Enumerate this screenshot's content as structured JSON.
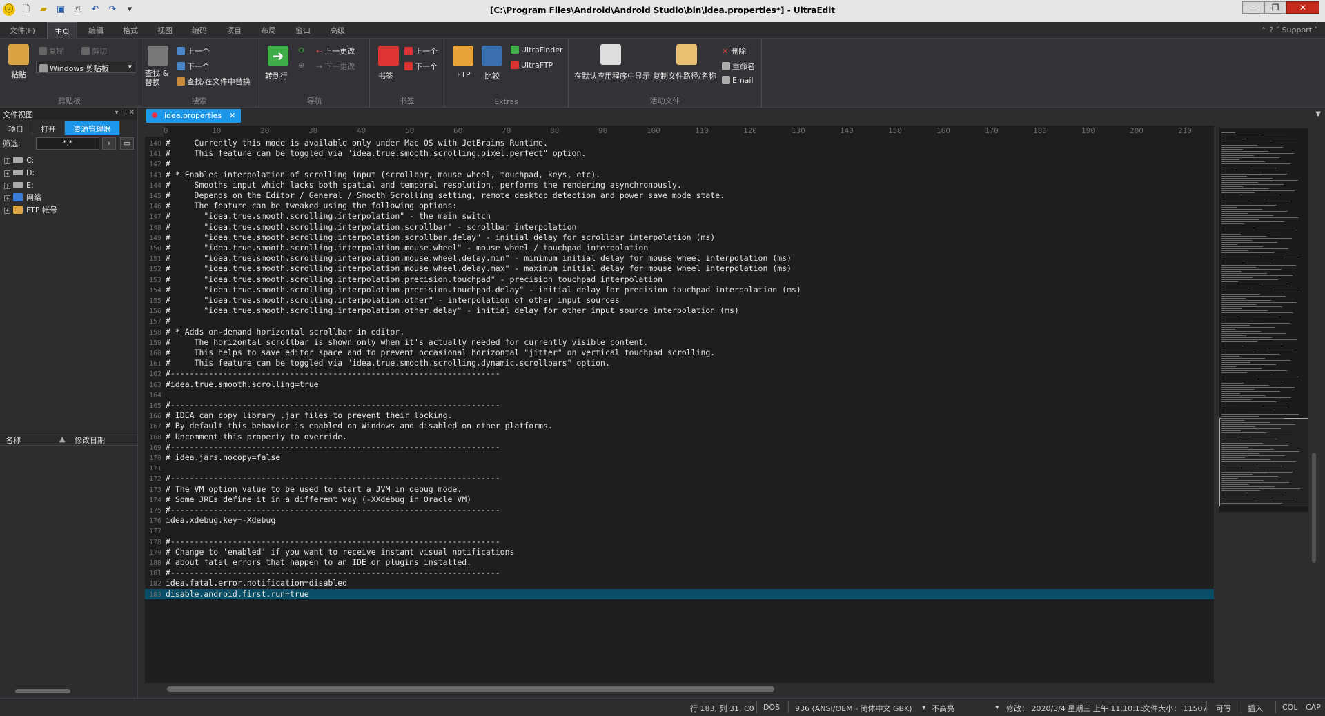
{
  "window": {
    "title": "[C:\\Program Files\\Android\\Android Studio\\bin\\idea.properties*] - UltraEdit",
    "min": "–",
    "max": "❐",
    "close": "✕"
  },
  "menubar": {
    "tabs": [
      "文件(F)",
      "主页",
      "编辑",
      "格式",
      "视图",
      "编码",
      "项目",
      "布局",
      "窗口",
      "高级"
    ],
    "active": "主页",
    "right": "⌃ ? ˅ Support ˅"
  },
  "ribbon": {
    "clipboard": {
      "paste": "粘贴",
      "copy": "复制",
      "cut": "剪切",
      "clip": "Windows 剪贴板",
      "label": "剪贴板"
    },
    "search": {
      "find_replace": "查找 &\n替换",
      "up": "上一个",
      "down": "下一个",
      "find_in_files": "查找/在文件中替换",
      "label": "搜索"
    },
    "nav": {
      "goto": "转到行",
      "prev_change": "上一更改",
      "next_change": "下一更改",
      "label": "导航"
    },
    "bookmarks": {
      "bookmark": "书签",
      "prev": "上一个",
      "next": "下一个",
      "label": "书签"
    },
    "extras": {
      "ftp": "FTP",
      "compare": "比较",
      "finder": "UltraFinder",
      "ultraftp": "UltraFTP",
      "label": "Extras"
    },
    "active": {
      "open_default": "在默认应用程序中显示",
      "copy_path": "复制文件路径/名称",
      "delete": "删除",
      "rename": "重命名",
      "email": "Email",
      "label": "活动文件"
    }
  },
  "sidebar": {
    "title": "文件视图",
    "tabs": [
      "项目",
      "打开",
      "资源管理器"
    ],
    "active_tab": "资源管理器",
    "filter_label": "筛选:",
    "filter_value": "*.*",
    "drives": [
      {
        "label": "C:"
      },
      {
        "label": "D:"
      },
      {
        "label": "E:"
      },
      {
        "label": "网络"
      },
      {
        "label": "FTP 帐号"
      }
    ],
    "col_name": "名称",
    "col_date": "修改日期"
  },
  "tab": {
    "name": "idea.properties",
    "close": "✕"
  },
  "lines": [
    {
      "n": "140",
      "t": "#     Currently this mode is available only under Mac OS with JetBrains Runtime."
    },
    {
      "n": "141",
      "t": "#     This feature can be toggled via \"idea.true.smooth.scrolling.pixel.perfect\" option."
    },
    {
      "n": "142",
      "t": "#"
    },
    {
      "n": "143",
      "t": "# * Enables interpolation of scrolling input (scrollbar, mouse wheel, touchpad, keys, etc)."
    },
    {
      "n": "144",
      "t": "#     Smooths input which lacks both spatial and temporal resolution, performs the rendering asynchronously."
    },
    {
      "n": "145",
      "t": "#     Depends on the Editor / General / Smooth Scrolling setting, remote desktop detection and power save mode state."
    },
    {
      "n": "146",
      "t": "#     The feature can be tweaked using the following options:"
    },
    {
      "n": "147",
      "t": "#       \"idea.true.smooth.scrolling.interpolation\" - the main switch"
    },
    {
      "n": "148",
      "t": "#       \"idea.true.smooth.scrolling.interpolation.scrollbar\" - scrollbar interpolation"
    },
    {
      "n": "149",
      "t": "#       \"idea.true.smooth.scrolling.interpolation.scrollbar.delay\" - initial delay for scrollbar interpolation (ms)"
    },
    {
      "n": "150",
      "t": "#       \"idea.true.smooth.scrolling.interpolation.mouse.wheel\" - mouse wheel / touchpad interpolation"
    },
    {
      "n": "151",
      "t": "#       \"idea.true.smooth.scrolling.interpolation.mouse.wheel.delay.min\" - minimum initial delay for mouse wheel interpolation (ms)"
    },
    {
      "n": "152",
      "t": "#       \"idea.true.smooth.scrolling.interpolation.mouse.wheel.delay.max\" - maximum initial delay for mouse wheel interpolation (ms)"
    },
    {
      "n": "153",
      "t": "#       \"idea.true.smooth.scrolling.interpolation.precision.touchpad\" - precision touchpad interpolation"
    },
    {
      "n": "154",
      "t": "#       \"idea.true.smooth.scrolling.interpolation.precision.touchpad.delay\" - initial delay for precision touchpad interpolation (ms)"
    },
    {
      "n": "155",
      "t": "#       \"idea.true.smooth.scrolling.interpolation.other\" - interpolation of other input sources"
    },
    {
      "n": "156",
      "t": "#       \"idea.true.smooth.scrolling.interpolation.other.delay\" - initial delay for other input source interpolation (ms)"
    },
    {
      "n": "157",
      "t": "#"
    },
    {
      "n": "158",
      "t": "# * Adds on-demand horizontal scrollbar in editor."
    },
    {
      "n": "159",
      "t": "#     The horizontal scrollbar is shown only when it's actually needed for currently visible content."
    },
    {
      "n": "160",
      "t": "#     This helps to save editor space and to prevent occasional horizontal \"jitter\" on vertical touchpad scrolling."
    },
    {
      "n": "161",
      "t": "#     This feature can be toggled via \"idea.true.smooth.scrolling.dynamic.scrollbars\" option."
    },
    {
      "n": "162",
      "t": "#---------------------------------------------------------------------"
    },
    {
      "n": "163",
      "t": "#idea.true.smooth.scrolling=true"
    },
    {
      "n": "164",
      "t": ""
    },
    {
      "n": "165",
      "t": "#---------------------------------------------------------------------"
    },
    {
      "n": "166",
      "t": "# IDEA can copy library .jar files to prevent their locking."
    },
    {
      "n": "167",
      "t": "# By default this behavior is enabled on Windows and disabled on other platforms."
    },
    {
      "n": "168",
      "t": "# Uncomment this property to override."
    },
    {
      "n": "169",
      "t": "#---------------------------------------------------------------------"
    },
    {
      "n": "170",
      "t": "# idea.jars.nocopy=false"
    },
    {
      "n": "171",
      "t": ""
    },
    {
      "n": "172",
      "t": "#---------------------------------------------------------------------"
    },
    {
      "n": "173",
      "t": "# The VM option value to be used to start a JVM in debug mode."
    },
    {
      "n": "174",
      "t": "# Some JREs define it in a different way (-XXdebug in Oracle VM)"
    },
    {
      "n": "175",
      "t": "#---------------------------------------------------------------------"
    },
    {
      "n": "176",
      "t": "idea.xdebug.key=-Xdebug"
    },
    {
      "n": "177",
      "t": ""
    },
    {
      "n": "178",
      "t": "#---------------------------------------------------------------------"
    },
    {
      "n": "179",
      "t": "# Change to 'enabled' if you want to receive instant visual notifications"
    },
    {
      "n": "180",
      "t": "# about fatal errors that happen to an IDE or plugins installed."
    },
    {
      "n": "181",
      "t": "#---------------------------------------------------------------------"
    },
    {
      "n": "182",
      "t": "idea.fatal.error.notification=disabled"
    },
    {
      "n": "183",
      "t": "disable.android.first.run=true"
    }
  ],
  "current_line": "183",
  "ruler": [
    "0",
    "10",
    "20",
    "30",
    "40",
    "50",
    "60",
    "70",
    "80",
    "90",
    "100",
    "110",
    "120",
    "130",
    "140",
    "150",
    "160",
    "170",
    "180",
    "190",
    "200",
    "210"
  ],
  "status": {
    "pos": "行 183, 列 31, C0",
    "eol": "DOS",
    "enc": "936  (ANSI/OEM - 简体中文 GBK)",
    "hl": "不高亮",
    "mod": "修改： 2020/3/4 星期三 上午 11:10:15",
    "size": "文件大小： 11507",
    "rw": "可写",
    "ins": "插入",
    "col": "COL",
    "cap": "CAP"
  }
}
